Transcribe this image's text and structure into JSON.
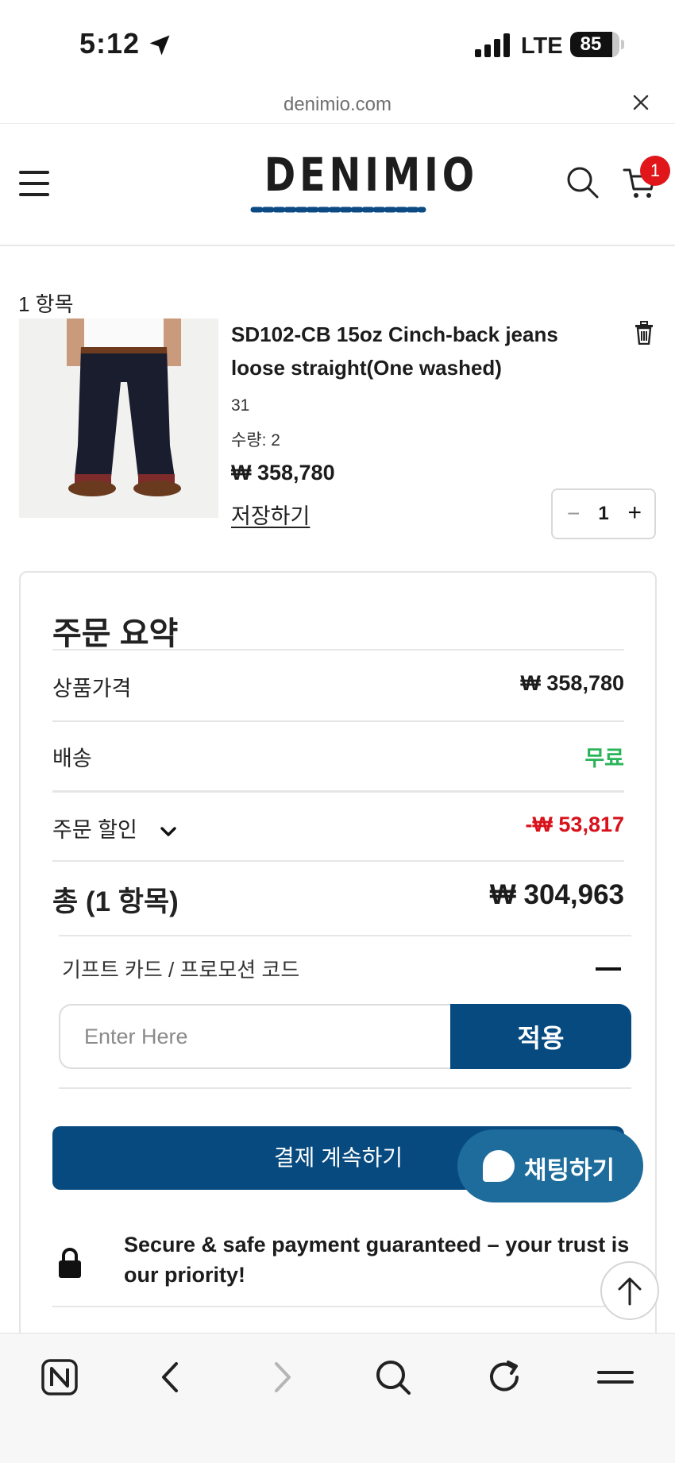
{
  "status_bar": {
    "time": "5:12",
    "network": "LTE",
    "battery": "85",
    "battery_level": 0.85
  },
  "browser": {
    "url": "denimio.com"
  },
  "header": {
    "logo": "DENIMIO",
    "cart_count": "1"
  },
  "cart": {
    "item_count_label": "1 항목",
    "item": {
      "title": "SD102-CB 15oz Cinch-back jeans loose straight(One washed)",
      "variant": "31",
      "quantity_label": "수량: 2",
      "price": "₩ 358,780",
      "save_later": "저장하기",
      "quantity": "1",
      "minus": "−",
      "plus": "+"
    }
  },
  "summary": {
    "title": "주문 요약",
    "subtotal_label": "상품가격",
    "subtotal_value": "₩ 358,780",
    "shipping_label": "배송",
    "shipping_value": "무료",
    "discount_label": "주문 할인",
    "discount_value": "-₩ 53,817",
    "total_label": "총 (1 항목)",
    "total_value": "₩ 304,963",
    "promo_label": "기프트 카드 / 프로모션 코드",
    "promo_placeholder": "Enter Here",
    "apply_label": "적용",
    "checkout_label": "결제 계속하기",
    "secure_bold": "Secure & safe",
    "secure_rest": " payment guaranteed – your trust is our priority!"
  },
  "chat": {
    "label": "채팅하기"
  },
  "colors": {
    "brand": "#074a80",
    "chat": "#1d6c9c",
    "free": "#2ab45a",
    "discount": "#d8111b",
    "badge": "#e0161b"
  }
}
